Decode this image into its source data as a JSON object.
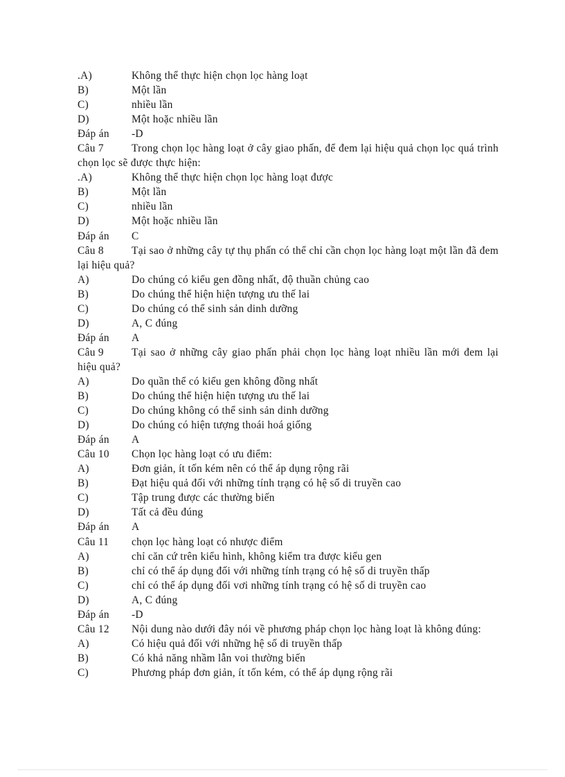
{
  "page": {
    "background_color": "#ffffff",
    "text_color": "#1a1a1a",
    "footer_rule_color": "#c8c8d2"
  },
  "labels": {
    "answer_label": "Đáp án",
    "option_a": "A)",
    "option_a_dotted": ".A)",
    "option_b": "B)",
    "option_c": "C)",
    "option_d": "D)"
  },
  "blocks": [
    {
      "id": "q6-options-tail",
      "options": [
        {
          "label": ".A)",
          "text": "Không thể thực hiện chọn lọc hàng loạt"
        },
        {
          "label": "B)",
          "text": "Một lần"
        },
        {
          "label": "C)",
          "text": "nhiều lần"
        },
        {
          "label": "D)",
          "text": "Một hoặc nhiều lần"
        }
      ],
      "answer": {
        "label": "Đáp án",
        "value": "-D"
      }
    },
    {
      "id": "q7",
      "question": {
        "number": "Câu 7",
        "text": "Trong chọn lọc hàng loạt ở cây giao phấn, để đem lại hiệu quả chọn lọc quá trình chọn lọc sẽ được thực hiện:"
      },
      "options": [
        {
          "label": ".A)",
          "text": "Không thể thực hiện chọn lọc hàng loạt được"
        },
        {
          "label": "B)",
          "text": "Một lần"
        },
        {
          "label": "C)",
          "text": "nhiều lần"
        },
        {
          "label": "D)",
          "text": "Một hoặc nhiều lần"
        }
      ],
      "answer": {
        "label": "Đáp án",
        "value": "C"
      }
    },
    {
      "id": "q8",
      "question": {
        "number": "Câu 8",
        "text": "Tại sao ở những cây tự thụ phấn có thể chỉ cần chọn lọc hàng loạt một lần đã đem lại hiệu quả?"
      },
      "options": [
        {
          "label": "A)",
          "text": "Do chúng có kiểu gen đồng nhất, độ thuần chủng cao"
        },
        {
          "label": "B)",
          "text": "Do chúng thể hiện hiện tượng ưu thế lai"
        },
        {
          "label": "C)",
          "text": "Do chúng có thể sinh sản dinh dưỡng"
        },
        {
          "label": "D)",
          "text": "A, C đúng"
        }
      ],
      "answer": {
        "label": "Đáp án",
        "value": "A"
      }
    },
    {
      "id": "q9",
      "question": {
        "number": "Câu 9",
        "text": "Tại sao ở những cây giao phấn phải chọn lọc hàng loạt nhiều lần mới đem lại hiệu quả?"
      },
      "options": [
        {
          "label": "A)",
          "text": "Do quần thể có kiểu gen không đồng nhất"
        },
        {
          "label": "B)",
          "text": "Do chúng thể hiện hiện tượng ưu thế lai"
        },
        {
          "label": "C)",
          "text": "Do chúng không có thể sinh sản dinh dưỡng"
        },
        {
          "label": "D)",
          "text": "Do chúng có hiện tượng thoái hoá giống"
        }
      ],
      "answer": {
        "label": "Đáp án",
        "value": "A"
      }
    },
    {
      "id": "q10",
      "question": {
        "number": "Câu 10",
        "text": "Chọn lọc hàng loạt có ưu điểm:"
      },
      "options": [
        {
          "label": "A)",
          "text": "Đơn giản, ít tốn kém nên có thể áp dụng rộng rãi"
        },
        {
          "label": "B)",
          "text": "Đạt hiệu quả đối với những tính trạng có hệ số di truyền cao"
        },
        {
          "label": "C)",
          "text": "Tập trung được các thường biến"
        },
        {
          "label": "D)",
          "text": "Tất cả đều đúng"
        }
      ],
      "answer": {
        "label": "Đáp án",
        "value": "A"
      }
    },
    {
      "id": "q11",
      "question": {
        "number": "Câu 11",
        "text": "chọn lọc hàng loạt có nhược điểm"
      },
      "options": [
        {
          "label": "A)",
          "text": "chỉ căn cứ trên kiểu hình, không kiểm tra được kiểu gen"
        },
        {
          "label": "B)",
          "text": "chỉ có thể áp dụng đối với những tính trạng có hệ số di truyền thấp"
        },
        {
          "label": "C)",
          "text": "chỉ có thể áp dụng đối vơi những tính trạng có hệ số di truyền cao"
        },
        {
          "label": "D)",
          "text": "A, C đúng"
        }
      ],
      "answer": {
        "label": "Đáp án",
        "value": "-D"
      }
    },
    {
      "id": "q12",
      "question": {
        "number": "Câu 12",
        "text": "Nội dung nào dưới đây nói về phương pháp chọn lọc hàng loạt là không đúng:"
      },
      "options": [
        {
          "label": "A)",
          "text": "Có hiệu quả đối với những hệ số di truyền thấp"
        },
        {
          "label": "B)",
          "text": "Có khả năng nhầm lẫn voi thường biến"
        },
        {
          "label": "C)",
          "text": "Phương pháp đơn giản, ít tốn kém, có thể áp dụng rộng rãi"
        }
      ]
    }
  ]
}
